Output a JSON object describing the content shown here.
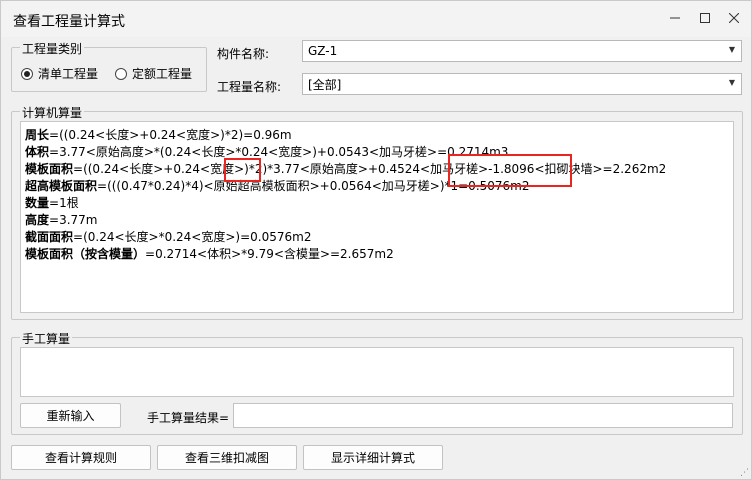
{
  "window": {
    "title": "查看工程量计算式"
  },
  "quantity_category": {
    "legend": "工程量类别",
    "options": [
      {
        "label": "清单工程量",
        "selected": true
      },
      {
        "label": "定额工程量",
        "selected": false
      }
    ]
  },
  "component": {
    "label": "构件名称:",
    "value": "GZ-1"
  },
  "quantity_name": {
    "label": "工程量名称:",
    "value": "[全部]"
  },
  "computer_calc": {
    "legend": "计算机算量",
    "lines": [
      {
        "name": "周长",
        "expr": "=((0.24<长度>+0.24<宽度>)*2)=0.96m"
      },
      {
        "name": "体积",
        "expr": "=3.77<原始高度>*(0.24<长度>*0.24<宽度>)+0.0543<加马牙槎>=0.2714m3"
      },
      {
        "name": "模板面积",
        "expr": "=((0.24<长度>+0.24<宽度>)*2)*3.77<原始高度>+0.4524<加马牙槎>-1.8096<扣砌块墙>=2.262m2"
      },
      {
        "name": "超高模板面积",
        "expr": "=(((0.47*0.24)*4)<原始超高模板面积>+0.0564<加马牙槎>)*1=0.5076m2"
      },
      {
        "name": "数量",
        "expr": "=1根"
      },
      {
        "name": "高度",
        "expr": "=3.77m"
      },
      {
        "name": "截面面积",
        "expr": "=(0.24<长度>*0.24<宽度>)=0.0576m2"
      },
      {
        "name": "模板面积（按含模量）",
        "expr": "=0.2714<体积>*9.79<含模量>=2.657m2"
      }
    ]
  },
  "manual_calc": {
    "legend": "手工算量",
    "reinput_button": "重新输入",
    "result_label": "手工算量结果=",
    "result_value": ""
  },
  "bottom_buttons": {
    "rules": "查看计算规则",
    "view3d": "查看三维扣减图",
    "details": "显示详细计算式"
  },
  "highlight_color": "#e8261f"
}
